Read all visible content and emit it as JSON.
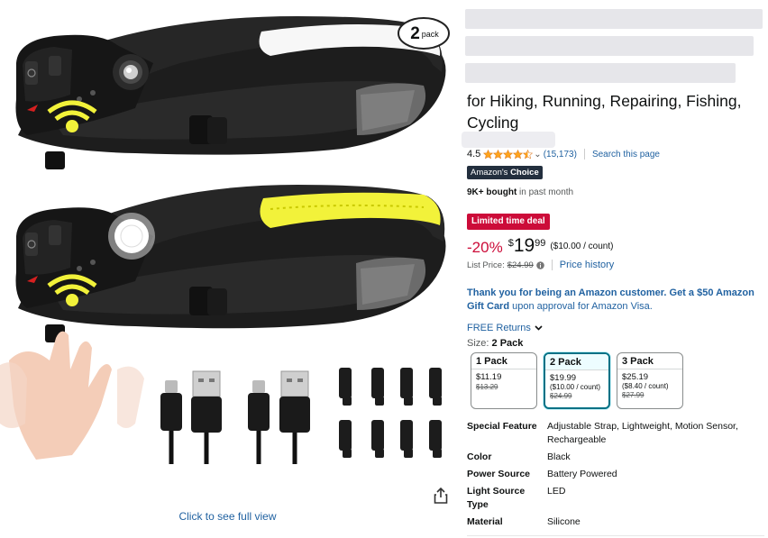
{
  "image": {
    "pack_badge_number": "2",
    "pack_badge_text": "pack",
    "see_full_view": "Click to see full view",
    "share_icon": "share-icon"
  },
  "product": {
    "title_visible": "for Hiking, Running, Repairing, Fishing, Cycling",
    "rating_value": "4.5",
    "rating_stars": 4.5,
    "review_count": "(15,173)",
    "search_page": "Search this page",
    "choice_badge_prefix": "Amazon's",
    "choice_badge_suffix": "Choice",
    "bought_bold": "9K+ bought",
    "bought_rest": " in past month",
    "deal_badge": "Limited time deal",
    "discount": "-20%",
    "price_symbol": "$",
    "price_whole": "19",
    "price_fraction": "99",
    "unit_price": "($10.00 / count)",
    "list_price_label": "List Price:",
    "list_price": "$24.99",
    "price_history": "Price history",
    "gift_bold": "Thank you for being an Amazon customer. Get a $50 Amazon Gift Card",
    "gift_rest": " upon approval for Amazon Visa.",
    "free_returns": "FREE Returns",
    "size_label": "Size:",
    "size_selected": "2 Pack"
  },
  "sizes": [
    {
      "name": "1 Pack",
      "price": "$11.19",
      "unit": "",
      "list": "$13.29",
      "selected": false
    },
    {
      "name": "2 Pack",
      "price": "$19.99",
      "unit": "($10.00 / count)",
      "list": "$24.99",
      "selected": true
    },
    {
      "name": "3 Pack",
      "price": "$25.19",
      "unit": "($8.40 / count)",
      "list": "$27.99",
      "selected": false
    }
  ],
  "specs": [
    {
      "key": "Special Feature",
      "value": "Adjustable Strap, Lightweight, Motion Sensor, Rechargeable"
    },
    {
      "key": "Color",
      "value": "Black"
    },
    {
      "key": "Power Source",
      "value": "Battery Powered"
    },
    {
      "key": "Light Source Type",
      "value": "LED"
    },
    {
      "key": "Material",
      "value": "Silicone"
    }
  ],
  "colors": {
    "link": "#2162a1",
    "deal": "#cc0c39",
    "star": "#ffa41c",
    "badge_dark": "#232f3e",
    "selected_border": "#007185",
    "cob_yellow": "#f2f23a"
  }
}
